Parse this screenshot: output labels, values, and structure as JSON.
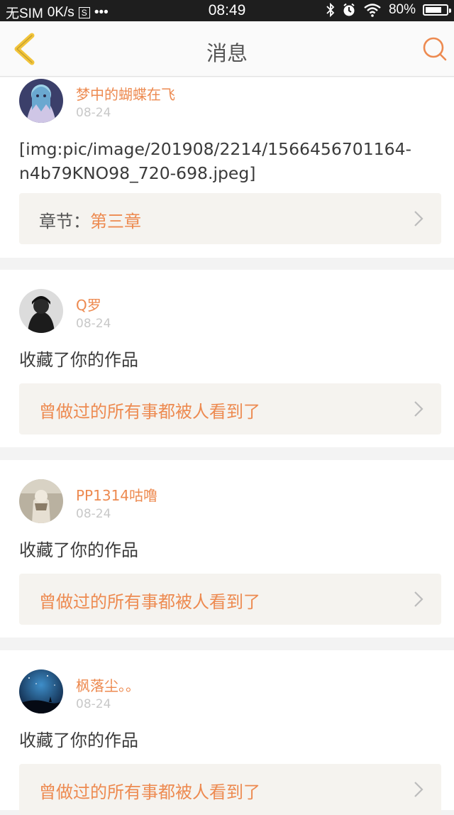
{
  "status_bar": {
    "carrier": "无SIM",
    "speed": "0K/s",
    "s_icon": "S",
    "more": "•••",
    "time": "08:49",
    "battery": "80%",
    "battery_level": 0.8
  },
  "header": {
    "title": "消息"
  },
  "messages": [
    {
      "username": "梦中的蝴蝶在飞",
      "date": "08-24",
      "text": "[img:pic/image/201908/2214/1566456701164-n4b79KNO98_720-698.jpeg]",
      "box_label": "章节：",
      "box_value": "第三章"
    },
    {
      "username": "Q罗",
      "date": "08-24",
      "text": "收藏了你的作品",
      "box_value": "曾做过的所有事都被人看到了"
    },
    {
      "username": "PP1314咕噜",
      "date": "08-24",
      "text": "收藏了你的作品",
      "box_value": "曾做过的所有事都被人看到了"
    },
    {
      "username": "枫落尘。。",
      "date": "08-24",
      "text": "收藏了你的作品",
      "box_value": "曾做过的所有事都被人看到了"
    }
  ],
  "colors": {
    "accent": "#ed8a50",
    "back_arrow": "#f2c43a",
    "box_bg": "#f5f3ef"
  }
}
